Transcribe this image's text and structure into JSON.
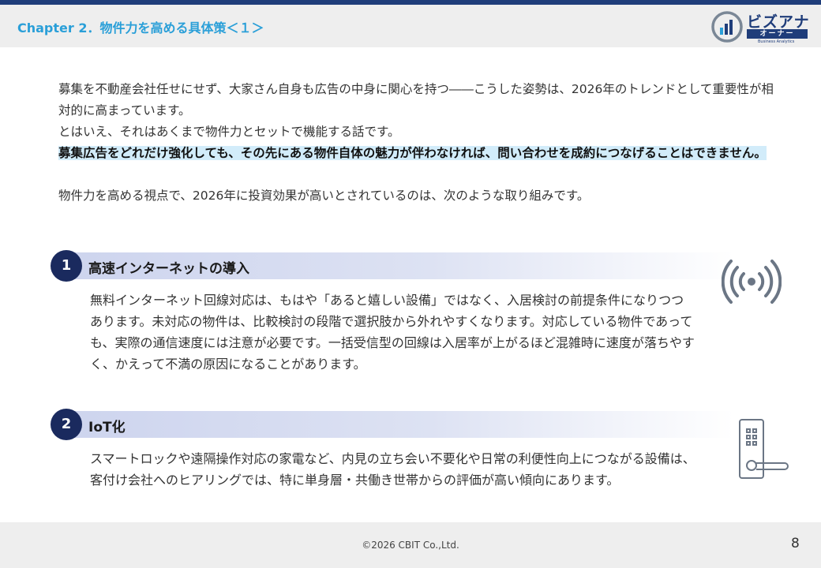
{
  "header": {
    "chapter_title": "Chapter 2．物件力を高める具体策＜１＞"
  },
  "logo": {
    "main_text": "ビズアナ",
    "sub_text": "オーナー",
    "small_text": "Business Analytics"
  },
  "intro": {
    "line1": "募集を不動産会社任せにせず、大家さん自身も広告の中身に関心を持つ――こうした姿勢は、2026年のトレンドとして重要性が相対的に高まっています。",
    "line2": "とはいえ、それはあくまで物件力とセットで機能する話です。",
    "highlight": "募集広告をどれだけ強化しても、その先にある物件自体の魅力が伴わなければ、問い合わせを成約につなげることはできません。",
    "line3": "物件力を高める視点で、2026年に投資効果が高いとされているのは、次のような取り組みです。"
  },
  "sections": [
    {
      "number": "1",
      "title": "高速インターネットの導入",
      "body": "無料インターネット回線対応は、もはや「あると嬉しい設備」ではなく、入居検討の前提条件になりつつあります。未対応の物件は、比較検討の段階で選択肢から外れやすくなります。対応している物件であっても、実際の通信速度には注意が必要です。一括受信型の回線は入居率が上がるほど混雑時に速度が落ちやすく、かえって不満の原因になることがあります。",
      "icon": "wifi-signal-icon"
    },
    {
      "number": "2",
      "title": "IoT化",
      "body": "スマートロックや遠隔操作対応の家電など、内見の立ち会い不要化や日常の利便性向上につながる設備は、客付け会社へのヒアリングでは、特に単身層・共働き世帯からの評価が高い傾向にあります。",
      "icon": "smart-lock-icon"
    }
  ],
  "footer": {
    "copyright": "©2026 CBIT Co.,Ltd.",
    "page_number": "8"
  },
  "colors": {
    "brand_navy": "#1f3d7a",
    "chapter_blue": "#2a9fd8",
    "badge_navy": "#1a2a5e",
    "highlight_bg": "#d2ecfa"
  }
}
